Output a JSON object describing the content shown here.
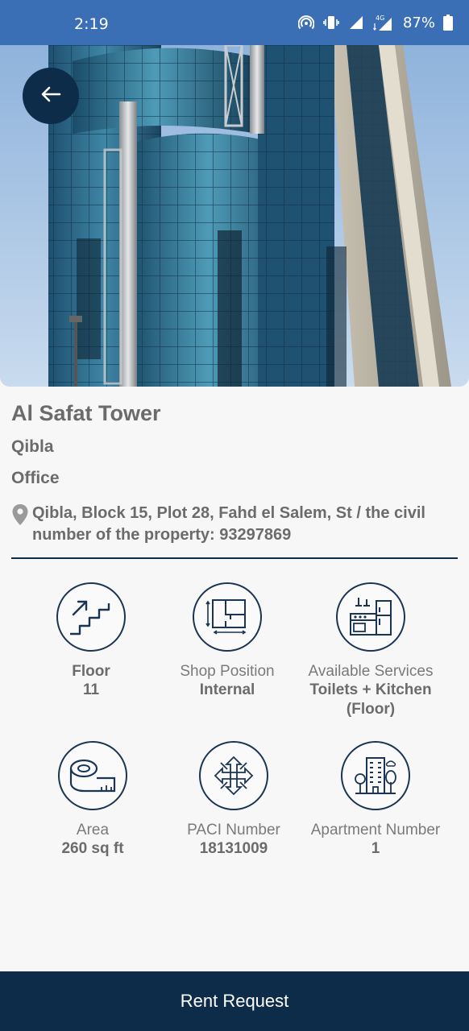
{
  "status_bar": {
    "time": "2:19",
    "battery": "87%",
    "icons": [
      "hotspot-icon",
      "vibrate-icon",
      "signal-icon",
      "lte-signal-icon",
      "battery-icon"
    ]
  },
  "hero": {
    "image_description_icon": "building-photo",
    "back_icon": "arrow-left-icon"
  },
  "property": {
    "name": "Al Safat Tower",
    "area": "Qibla",
    "type": "Office",
    "address": "Qibla, Block 15, Plot 28, Fahd el Salem, St / the civil number of the property: 93297869"
  },
  "features": [
    {
      "label": "Floor",
      "value": "11",
      "icon": "stairs-icon"
    },
    {
      "label": "Shop Position",
      "value": "Internal",
      "icon": "floor-plan-icon"
    },
    {
      "label": "Available Services",
      "value": "Toilets + Kitchen (Floor)",
      "icon": "kitchen-icon"
    },
    {
      "label": "Area",
      "value": "260 sq ft",
      "icon": "measuring-tape-icon"
    },
    {
      "label": "PACI Number",
      "value": "18131009",
      "icon": "network-icon"
    },
    {
      "label": "Apartment Number",
      "value": "1",
      "icon": "apartment-building-icon"
    }
  ],
  "actions": {
    "rent_request": "Rent Request"
  },
  "colors": {
    "status_bar": "#3a6fb6",
    "primary_dark": "#0d2c4a",
    "text_gray": "#6b6b6b"
  }
}
